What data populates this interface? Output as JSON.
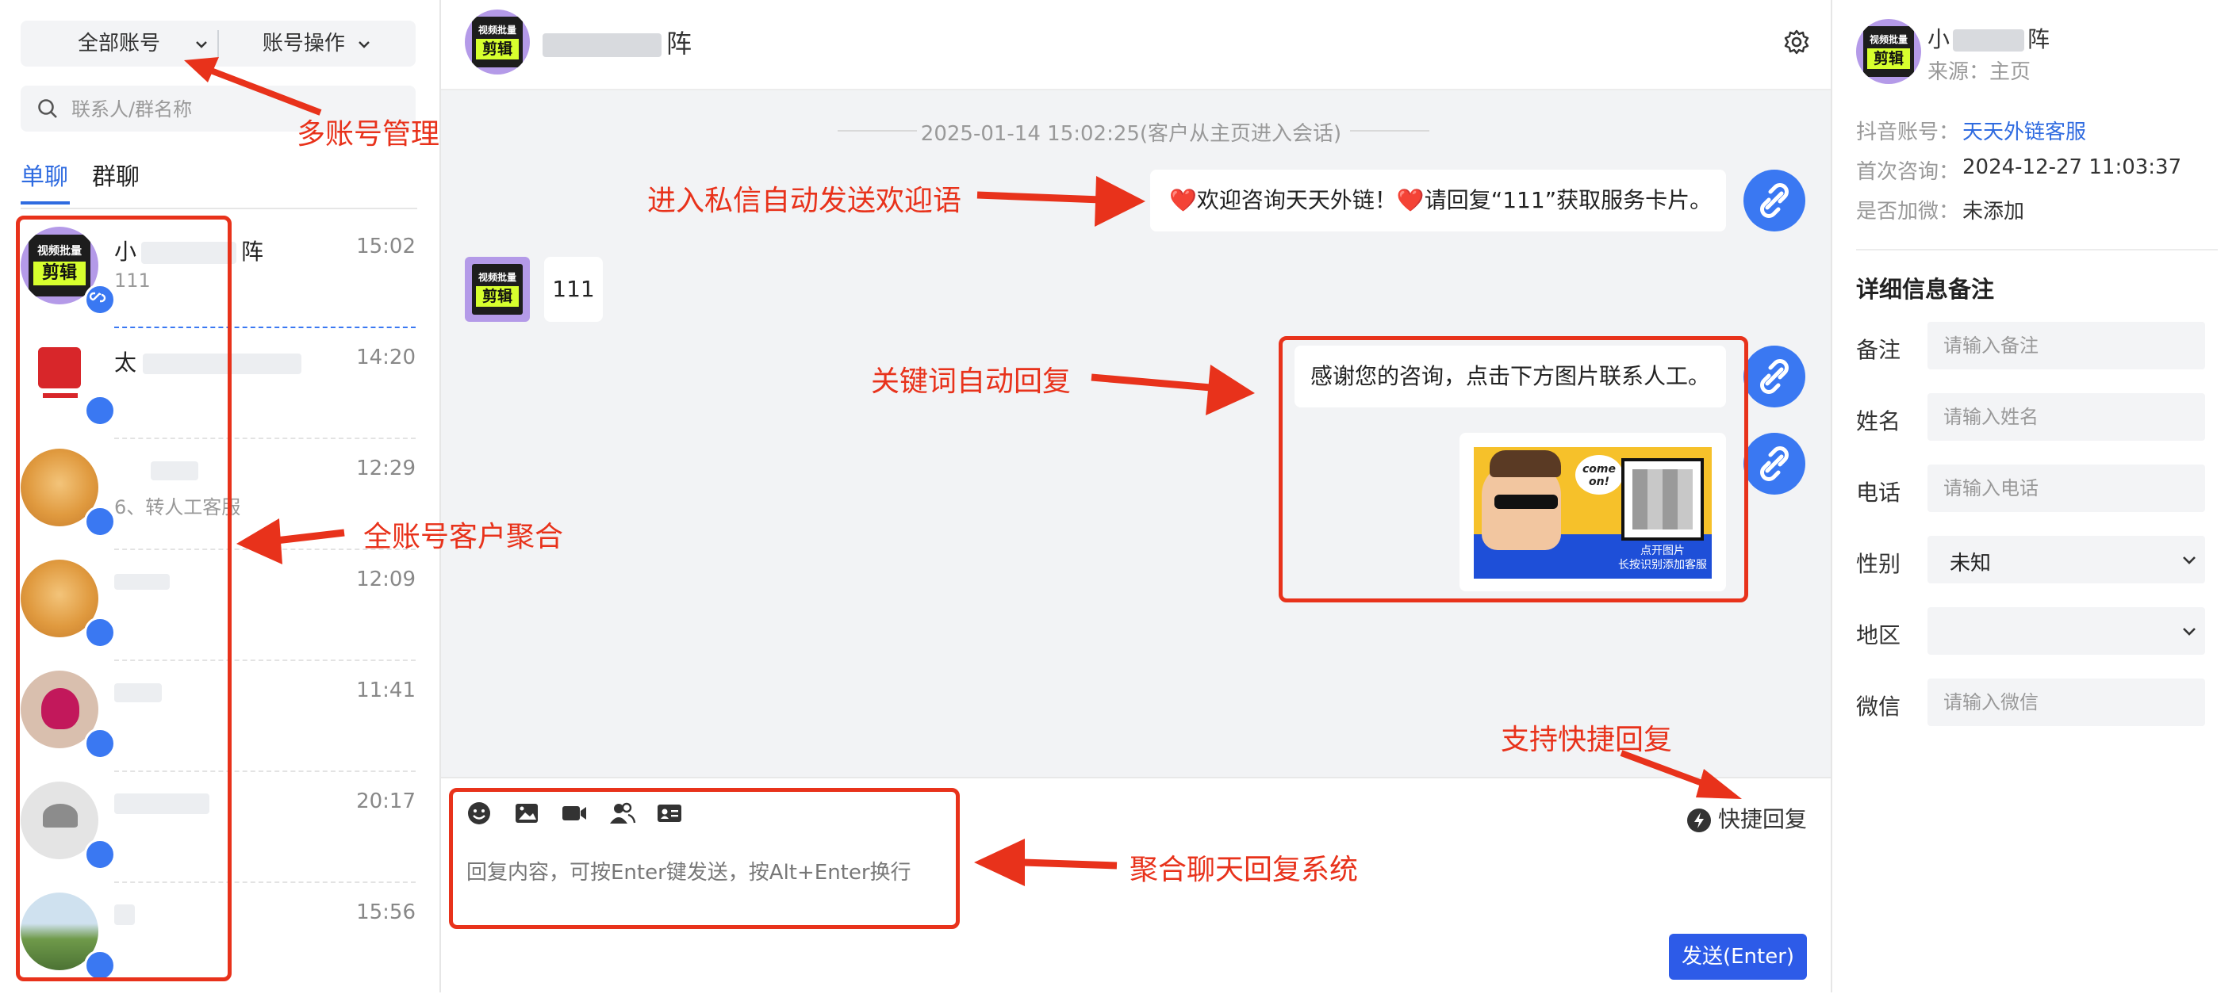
{
  "left": {
    "account_switch": "全部账号",
    "account_ops": "账号操作",
    "search_placeholder": "联系人/群名称",
    "tabs": [
      "单聊",
      "群聊"
    ],
    "conversations": [
      {
        "name": "小",
        "name_tail": "阵",
        "preview": "111",
        "time": "15:02",
        "avatar": "video-batch-edit-logo"
      },
      {
        "name": "太",
        "name_tail": "",
        "preview": "",
        "time": "14:20",
        "avatar": "red-brand-logo"
      },
      {
        "name": "",
        "name_tail": "",
        "preview": "6、转人工客服",
        "time": "12:29",
        "avatar": "cat-photo"
      },
      {
        "name": "",
        "name_tail": "",
        "preview": "",
        "time": "12:09",
        "avatar": "cat-photo"
      },
      {
        "name": "",
        "name_tail": "",
        "preview": "",
        "time": "11:41",
        "avatar": "red-flower-logo"
      },
      {
        "name": "",
        "name_tail": "",
        "preview": "",
        "time": "20:17",
        "avatar": "lotus-logo"
      },
      {
        "name": "",
        "name_tail": "",
        "preview": "",
        "time": "15:56",
        "avatar": "landscape-photo"
      }
    ]
  },
  "chat": {
    "title_tail": "阵",
    "timestamp": "2025-01-14 15:02:25(客户从主页进入会话)",
    "welcome": "❤️欢迎咨询天天外链！❤️请回复“111”获取服务卡片。",
    "user_msg": "111",
    "auto_reply": "感谢您的咨询，点击下方图片联系人工。",
    "card_caption_1": "点开图片",
    "card_caption_2": "长按识别添加客服",
    "card_bubble": "come on!",
    "composer_placeholder": "回复内容，可按Enter键发送，按Alt+Enter换行",
    "quick_reply": "快捷回复",
    "send": "发送(Enter)"
  },
  "right": {
    "name_head": "小",
    "name_tail": "阵",
    "source": "来源：主页",
    "douyin_label": "抖音账号：",
    "douyin_value": "天天外链客服",
    "first_label": "首次咨询：",
    "first_value": "2024-12-27 11:03:37",
    "wechat_added_label": "是否加微：",
    "wechat_added_value": "未添加",
    "section_title": "详细信息备注",
    "fields": {
      "remark_label": "备注",
      "remark_placeholder": "请输入备注",
      "name_label": "姓名",
      "name_placeholder": "请输入姓名",
      "phone_label": "电话",
      "phone_placeholder": "请输入电话",
      "gender_label": "性别",
      "gender_value": "未知",
      "region_label": "地区",
      "region_value": "",
      "wechat_label": "微信",
      "wechat_placeholder": "请输入微信"
    }
  },
  "logo_text": {
    "top": "视频批量",
    "bottom": "剪辑"
  },
  "annotations": {
    "multi_account": "多账号管理",
    "welcome": "进入私信自动发送欢迎语",
    "keyword": "关键词自动回复",
    "aggregate": "全账号客户聚合",
    "quick": "支持快捷回复",
    "reply_system": "聚合聊天回复系统"
  },
  "colors": {
    "accent": "#2f6be0",
    "annotation": "#e8321b",
    "send": "#2d5be8"
  }
}
